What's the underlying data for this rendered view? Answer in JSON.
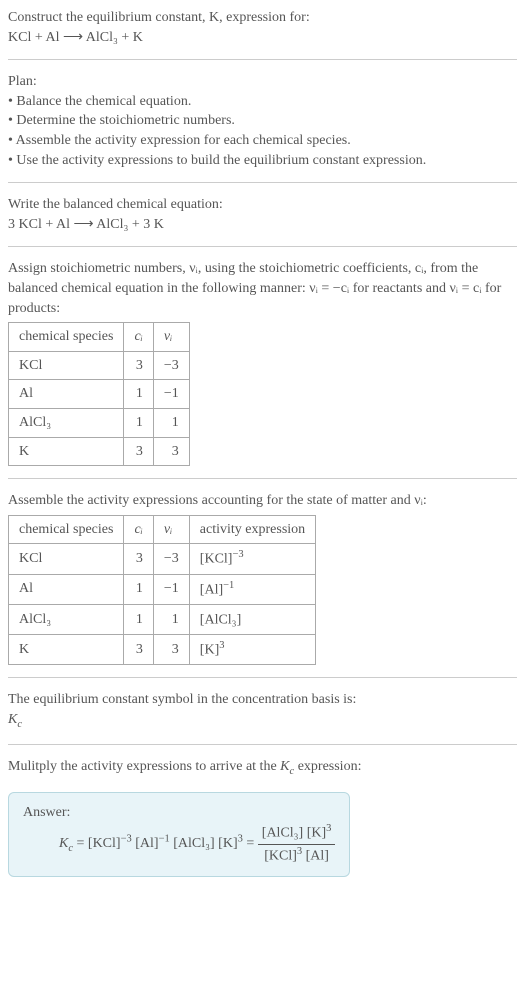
{
  "intro": {
    "line1": "Construct the equilibrium constant, K, expression for:",
    "line2": "KCl + Al ⟶ AlCl₃ + K"
  },
  "plan": {
    "heading": "Plan:",
    "items": [
      "• Balance the chemical equation.",
      "• Determine the stoichiometric numbers.",
      "• Assemble the activity expression for each chemical species.",
      "• Use the activity expressions to build the equilibrium constant expression."
    ]
  },
  "balanced": {
    "heading": "Write the balanced chemical equation:",
    "equation": "3 KCl + Al ⟶ AlCl₃ + 3 K"
  },
  "stoich": {
    "text": "Assign stoichiometric numbers, νᵢ, using the stoichiometric coefficients, cᵢ, from the balanced chemical equation in the following manner: νᵢ = −cᵢ for reactants and νᵢ = cᵢ for products:",
    "headers": [
      "chemical species",
      "cᵢ",
      "νᵢ"
    ],
    "rows": [
      [
        "KCl",
        "3",
        "−3"
      ],
      [
        "Al",
        "1",
        "−1"
      ],
      [
        "AlCl₃",
        "1",
        "1"
      ],
      [
        "K",
        "3",
        "3"
      ]
    ]
  },
  "activity": {
    "text": "Assemble the activity expressions accounting for the state of matter and νᵢ:",
    "headers": [
      "chemical species",
      "cᵢ",
      "νᵢ",
      "activity expression"
    ],
    "rows": [
      {
        "species": "KCl",
        "c": "3",
        "v": "−3",
        "expr_base": "[KCl]",
        "expr_sup": "−3"
      },
      {
        "species": "Al",
        "c": "1",
        "v": "−1",
        "expr_base": "[Al]",
        "expr_sup": "−1"
      },
      {
        "species": "AlCl₃",
        "c": "1",
        "v": "1",
        "expr_base": "[AlCl₃]",
        "expr_sup": ""
      },
      {
        "species": "K",
        "c": "3",
        "v": "3",
        "expr_base": "[K]",
        "expr_sup": "3"
      }
    ]
  },
  "symbol": {
    "text": "The equilibrium constant symbol in the concentration basis is:",
    "value": "K_c"
  },
  "multiply": {
    "text": "Mulitply the activity expressions to arrive at the K_c expression:"
  },
  "answer": {
    "label": "Answer:",
    "lhs_prefix": "K",
    "lhs_sub": "c",
    "eq1": " = [KCl]",
    "eq1_sup": "−3",
    "eq2": " [Al]",
    "eq2_sup": "−1",
    "eq3": " [AlCl₃] [K]",
    "eq3_sup": "3",
    "eq4": " = ",
    "frac_num_a": "[AlCl₃] [K]",
    "frac_num_sup": "3",
    "frac_den_a": "[KCl]",
    "frac_den_sup": "3",
    "frac_den_b": " [Al]"
  }
}
